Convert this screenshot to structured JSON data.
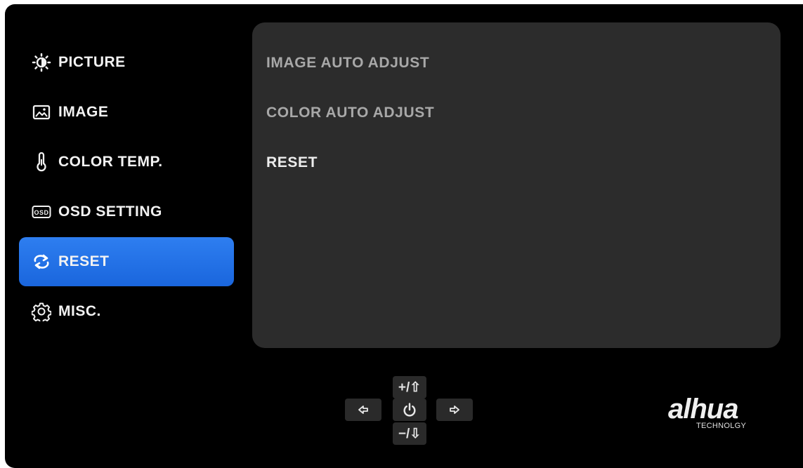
{
  "sidebar": {
    "items": [
      {
        "label": "PICTURE",
        "icon": "brightness-icon"
      },
      {
        "label": "IMAGE",
        "icon": "image-icon"
      },
      {
        "label": "COLOR TEMP.",
        "icon": "thermometer-icon"
      },
      {
        "label": "OSD SETTING",
        "icon": "osd-icon",
        "icon_text": "OSD"
      },
      {
        "label": "RESET",
        "icon": "refresh-icon",
        "selected": true
      },
      {
        "label": "MISC.",
        "icon": "gear-icon"
      }
    ]
  },
  "content": {
    "items": [
      {
        "label": "IMAGE AUTO ADJUST"
      },
      {
        "label": "COLOR AUTO ADJUST"
      },
      {
        "label": "RESET",
        "highlighted": true
      }
    ]
  },
  "controls": {
    "up_label": "+/⇧",
    "down_label": "−/⇩",
    "left_icon": "exit-icon",
    "center_icon": "power-icon",
    "right_icon": "enter-icon"
  },
  "brand": {
    "logo": "alhua",
    "sub": "TECHNOLGY"
  },
  "colors": {
    "accent": "#1f6fe5",
    "panel": "#2c2c2c",
    "background": "#000000"
  }
}
